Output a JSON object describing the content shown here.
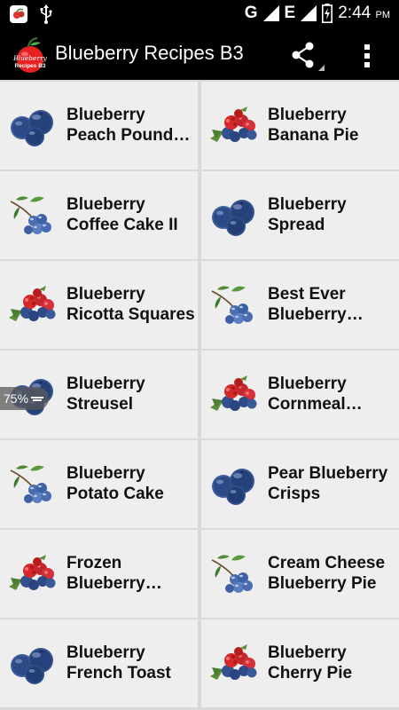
{
  "status_bar": {
    "network": "G",
    "network2": "E",
    "time": "2:44",
    "ampm": "PM"
  },
  "app_bar": {
    "logo_text_1": "Blueberry",
    "logo_text_2": "Recipes B3",
    "title": "Blueberry Recipes B3"
  },
  "zoom": {
    "label": "75%"
  },
  "recipes": [
    {
      "line1": "Blueberry",
      "line2": "Peach Pound…",
      "thumb": "blueberries"
    },
    {
      "line1": "Blueberry",
      "line2": "Banana Pie",
      "thumb": "mixed-berries"
    },
    {
      "line1": "Blueberry",
      "line2": "Coffee Cake II",
      "thumb": "berry-branch"
    },
    {
      "line1": "Blueberry",
      "line2": "Spread",
      "thumb": "blueberries"
    },
    {
      "line1": "Blueberry",
      "line2": "Ricotta Squares",
      "thumb": "mixed-berries"
    },
    {
      "line1": "Best Ever",
      "line2": "Blueberry…",
      "thumb": "berry-branch"
    },
    {
      "line1": "Blueberry",
      "line2": "Streusel",
      "thumb": "blueberries"
    },
    {
      "line1": "Blueberry",
      "line2": "Cornmeal…",
      "thumb": "mixed-berries"
    },
    {
      "line1": "Blueberry",
      "line2": "Potato Cake",
      "thumb": "berry-branch"
    },
    {
      "line1": "Pear Blueberry",
      "line2": "Crisps",
      "thumb": "blueberries"
    },
    {
      "line1": "Frozen",
      "line2": "Blueberry…",
      "thumb": "mixed-berries"
    },
    {
      "line1": "Cream Cheese",
      "line2": "Blueberry Pie",
      "thumb": "berry-branch"
    },
    {
      "line1": "Blueberry",
      "line2": "French Toast",
      "thumb": "blueberries"
    },
    {
      "line1": "Blueberry",
      "line2": "Cherry Pie",
      "thumb": "mixed-berries"
    }
  ]
}
